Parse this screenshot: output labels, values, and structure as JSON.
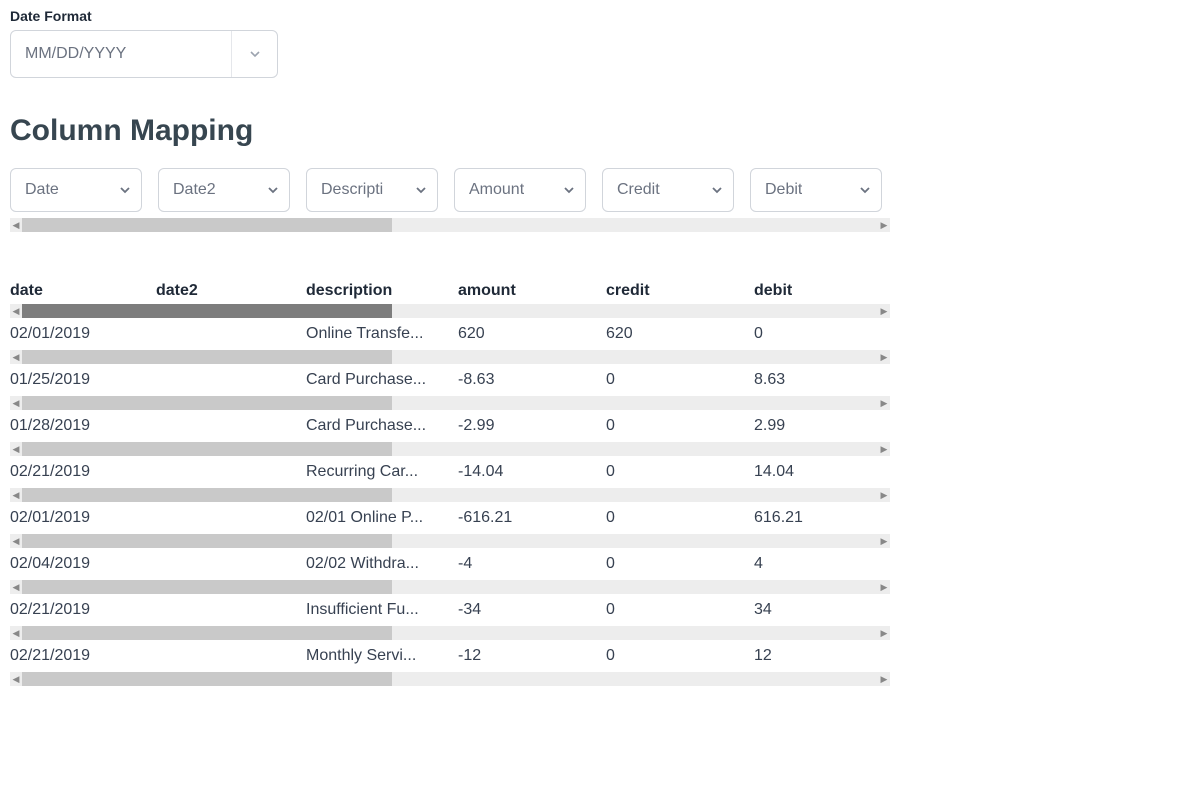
{
  "date_format": {
    "label": "Date Format",
    "value": "MM/DD/YYYY"
  },
  "headline": "Column Mapping",
  "mappers": [
    {
      "label": "Date"
    },
    {
      "label": "Date2"
    },
    {
      "label": "Descripti"
    },
    {
      "label": "Amount"
    },
    {
      "label": "Credit"
    },
    {
      "label": "Debit"
    }
  ],
  "table": {
    "headers": [
      "date",
      "date2",
      "description",
      "amount",
      "credit",
      "debit"
    ],
    "rows": [
      {
        "date": "02/01/2019",
        "date2": "",
        "description": "Online Transfe...",
        "amount": "620",
        "credit": "620",
        "debit": "0"
      },
      {
        "date": "01/25/2019",
        "date2": "",
        "description": "Card Purchase...",
        "amount": "-8.63",
        "credit": "0",
        "debit": "8.63"
      },
      {
        "date": "01/28/2019",
        "date2": "",
        "description": "Card Purchase...",
        "amount": "-2.99",
        "credit": "0",
        "debit": "2.99"
      },
      {
        "date": "02/21/2019",
        "date2": "",
        "description": "Recurring Car...",
        "amount": "-14.04",
        "credit": "0",
        "debit": "14.04"
      },
      {
        "date": "02/01/2019",
        "date2": "",
        "description": "02/01 Online P...",
        "amount": "-616.21",
        "credit": "0",
        "debit": "616.21"
      },
      {
        "date": "02/04/2019",
        "date2": "",
        "description": "02/02 Withdra...",
        "amount": "-4",
        "credit": "0",
        "debit": "4"
      },
      {
        "date": "02/21/2019",
        "date2": "",
        "description": "Insufficient Fu...",
        "amount": "-34",
        "credit": "0",
        "debit": "34"
      },
      {
        "date": "02/21/2019",
        "date2": "",
        "description": "Monthly Servi...",
        "amount": "-12",
        "credit": "0",
        "debit": "12"
      }
    ]
  }
}
